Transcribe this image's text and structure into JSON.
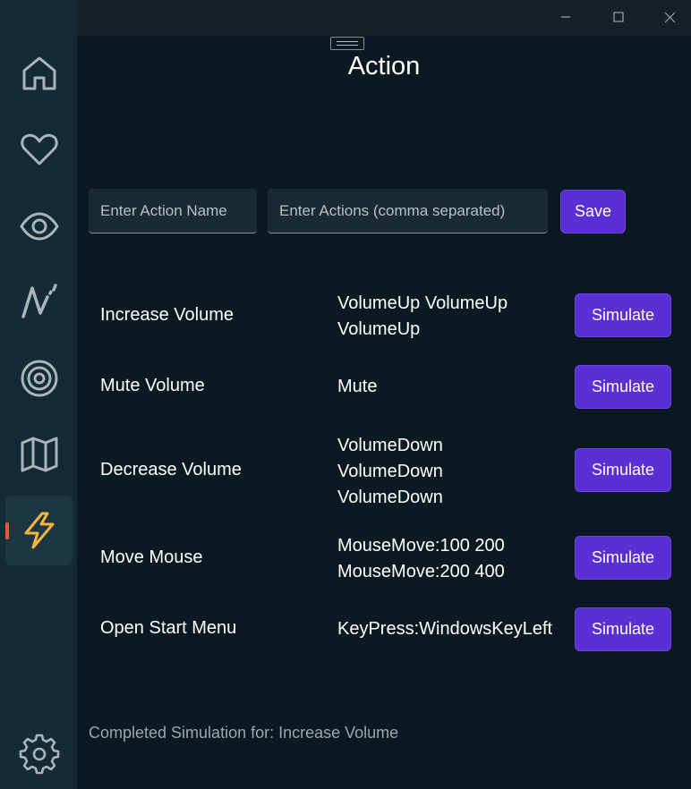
{
  "sidebar": {
    "items": [
      {
        "icon": "home-icon"
      },
      {
        "icon": "heart-icon"
      },
      {
        "icon": "eye-icon"
      },
      {
        "icon": "pen-stroke-icon"
      },
      {
        "icon": "target-icon"
      },
      {
        "icon": "map-icon"
      },
      {
        "icon": "lightning-icon",
        "active": true
      }
    ],
    "footer_icon": "gear-icon",
    "active_color": "#e8593c",
    "lightning_color": "#f5b53f"
  },
  "page": {
    "title": "Action"
  },
  "form": {
    "action_name_placeholder": "Enter Action Name",
    "actions_placeholder": "Enter Actions (comma separated)",
    "save_label": "Save"
  },
  "actions": [
    {
      "name": "Increase Volume",
      "lines": [
        "VolumeUp VolumeUp",
        "VolumeUp"
      ],
      "button": "Simulate"
    },
    {
      "name": "Mute Volume",
      "lines": [
        "Mute"
      ],
      "button": "Simulate"
    },
    {
      "name": "Decrease Volume",
      "lines": [
        "VolumeDown",
        "VolumeDown",
        "VolumeDown"
      ],
      "button": "Simulate"
    },
    {
      "name": "Move Mouse",
      "lines": [
        "MouseMove:100 200",
        "MouseMove:200 400"
      ],
      "button": "Simulate"
    },
    {
      "name": "Open Start Menu",
      "lines": [
        "KeyPress:WindowsKeyLeft"
      ],
      "button": "Simulate"
    }
  ],
  "status": {
    "text": "Completed Simulation for: Increase Volume"
  },
  "colors": {
    "accent": "#5a2fd6",
    "background": "#0b1a22",
    "sidebar": "#142a36"
  }
}
